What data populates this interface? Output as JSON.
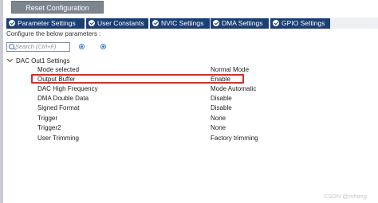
{
  "toolbar": {
    "reset_label": "Reset Configuration"
  },
  "tabs": [
    {
      "label": "Parameter Settings",
      "active": true
    },
    {
      "label": "User Constants",
      "active": false
    },
    {
      "label": "NVIC Settings",
      "active": false
    },
    {
      "label": "DMA Settings",
      "active": false
    },
    {
      "label": "GPIO Settings",
      "active": false
    }
  ],
  "panel": {
    "configure_text": "Configure the below parameters :",
    "search_placeholder": "Search (Ctrl+F)"
  },
  "group": {
    "title": "DAC Out1 Settings",
    "rows": [
      {
        "label": "Mode selected",
        "value": "Normal Mode"
      },
      {
        "label": "Output Buffer",
        "value": "Enable",
        "highlighted": true
      },
      {
        "label": "DAC High Frequency",
        "value": "Mode Automatic"
      },
      {
        "label": "DMA Double Data",
        "value": "Disable"
      },
      {
        "label": "Signed Format",
        "value": "Disable"
      },
      {
        "label": "Trigger",
        "value": "None"
      },
      {
        "label": "Trigger2",
        "value": "None"
      },
      {
        "label": "User Trimming",
        "value": "Factory trimming"
      }
    ]
  },
  "watermark": "CSDN @mftang",
  "colors": {
    "tab_bg": "#1b3f74",
    "reset_bg": "#7d858f",
    "highlight_border": "#e0282a"
  },
  "icons": [
    "check-circle-icon",
    "search-icon",
    "previous-match-icon",
    "next-match-icon",
    "chevron-down-icon"
  ]
}
